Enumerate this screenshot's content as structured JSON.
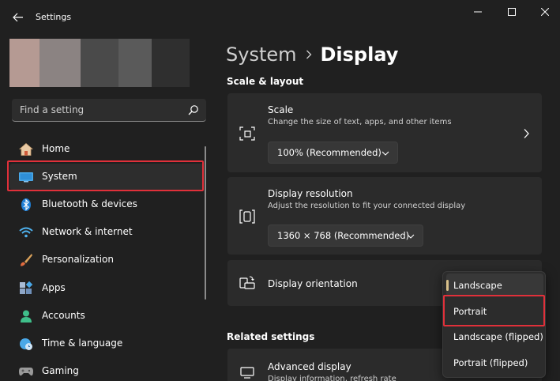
{
  "window": {
    "title": "Settings",
    "controls": [
      "minimize",
      "maximize",
      "close"
    ]
  },
  "sidebar": {
    "search": {
      "placeholder": "Find a setting",
      "value": ""
    },
    "items": [
      {
        "label": "Home",
        "icon": "home-icon",
        "selected": false
      },
      {
        "label": "System",
        "icon": "monitor-icon",
        "selected": true
      },
      {
        "label": "Bluetooth & devices",
        "icon": "bluetooth-icon",
        "selected": false
      },
      {
        "label": "Network & internet",
        "icon": "wifi-icon",
        "selected": false
      },
      {
        "label": "Personalization",
        "icon": "brush-icon",
        "selected": false
      },
      {
        "label": "Apps",
        "icon": "apps-icon",
        "selected": false
      },
      {
        "label": "Accounts",
        "icon": "account-icon",
        "selected": false
      },
      {
        "label": "Time & language",
        "icon": "globe-clock-icon",
        "selected": false
      },
      {
        "label": "Gaming",
        "icon": "gamepad-icon",
        "selected": false
      }
    ]
  },
  "main": {
    "breadcrumb": {
      "parent": "System",
      "current": "Display"
    },
    "sections": {
      "scale_layout": "Scale & layout",
      "related": "Related settings"
    },
    "scale": {
      "title": "Scale",
      "description": "Change the size of text, apps, and other items",
      "value": "100% (Recommended)"
    },
    "resolution": {
      "title": "Display resolution",
      "description": "Adjust the resolution to fit your connected display",
      "value": "1360 × 768 (Recommended)"
    },
    "orientation": {
      "title": "Display orientation",
      "options": [
        "Landscape",
        "Portrait",
        "Landscape (flipped)",
        "Portrait (flipped)"
      ],
      "selected": "Landscape",
      "highlighted": "Portrait"
    },
    "advanced": {
      "title": "Advanced display",
      "description": "Display information, refresh rate"
    }
  },
  "colors": {
    "background": "#202020",
    "card": "#2b2b2b",
    "accent": "#d8c08a",
    "highlight_box": "#e0303a"
  }
}
